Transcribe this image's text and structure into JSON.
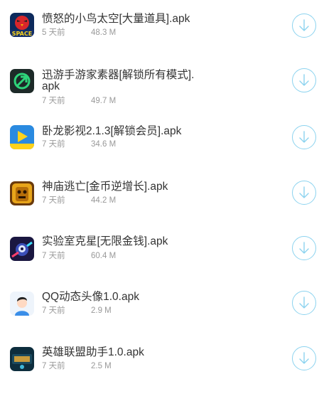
{
  "accent_color": "#8cd3ef",
  "apps": [
    {
      "title": "愤怒的小鸟太空[大量道具].apk",
      "time": "5 天前",
      "size": "48.3 M",
      "icon": "angry-birds-space-icon"
    },
    {
      "title": "迅游手游家素器[解锁所有模式].apk",
      "time": "7 天前",
      "size": "49.7 M",
      "icon": "xunyou-icon"
    },
    {
      "title": "卧龙影视2.1.3[解锁会员].apk",
      "time": "7 天前",
      "size": "34.6 M",
      "icon": "wolong-video-icon"
    },
    {
      "title": "神庙逃亡[金币逆增长].apk",
      "time": "7 天前",
      "size": "44.2 M",
      "icon": "temple-run-icon"
    },
    {
      "title": "实验室克星[无限金钱].apk",
      "time": "7 天前",
      "size": "60.4 M",
      "icon": "lab-buster-icon"
    },
    {
      "title": "QQ动态头像1.0.apk",
      "time": "7 天前",
      "size": "2.9 M",
      "icon": "qq-avatar-icon"
    },
    {
      "title": "英雄联盟助手1.0.apk",
      "time": "7 天前",
      "size": "2.5 M",
      "icon": "lol-helper-icon"
    }
  ]
}
